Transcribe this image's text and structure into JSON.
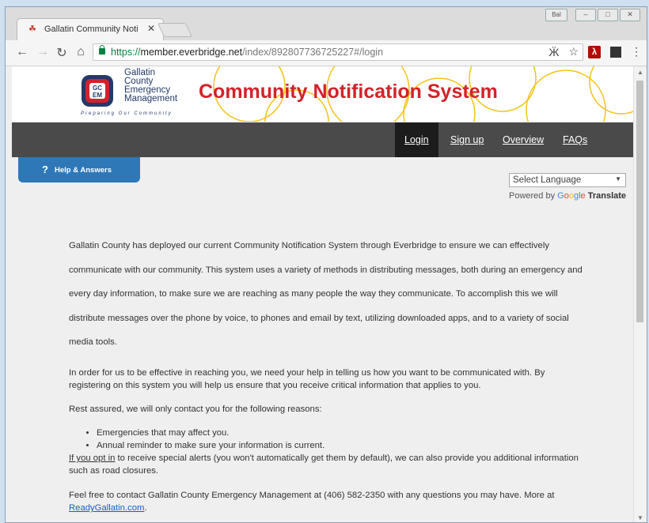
{
  "browser": {
    "tab_title": "Gallatin Community Noti",
    "url_scheme": "https://",
    "url_host": "member.everbridge.net",
    "url_path": "/index/892807736725227#/login",
    "user_badge": "Bal"
  },
  "site": {
    "logo_line1": "Gallatin",
    "logo_line2": "County",
    "logo_line3": "Emergency",
    "logo_line4": "Management",
    "logo_tagline": "Preparing Our Community",
    "title": "Community Notification System",
    "colors": {
      "accent_red": "#d3222a",
      "nav_bg": "#4a4a4a",
      "help_blue": "#2f78b8",
      "arc_yellow": "#f2c419"
    }
  },
  "nav": {
    "items": [
      {
        "label": "Login"
      },
      {
        "label": "Sign up"
      },
      {
        "label": "Overview"
      },
      {
        "label": "FAQs"
      }
    ]
  },
  "help": {
    "label": "Help & Answers",
    "icon": "question-icon"
  },
  "translate": {
    "select_value": "Select Language",
    "powered_by": "Powered by",
    "google_G": "G",
    "google_o1": "o",
    "google_o2": "o",
    "google_g": "g",
    "google_l": "l",
    "google_e": "e",
    "translate_word": "Translate"
  },
  "content": {
    "intro": "Gallatin County has deployed our current Community Notification System through Everbridge to ensure we can effectively communicate with our community.  This system uses a variety of methods in distributing messages, both during an emergency and every day information, to make sure we are reaching as many people the way they communicate.  To accomplish this we will distribute messages over the phone by voice, to phones and email by text, utilizing downloaded apps, and to a variety of social media tools.",
    "help_request": "In order for us to be effective in reaching you, we need your help in telling us how you want to be communicated with.  By registering on this system you will help us ensure that you receive critical information that applies to you.",
    "rest_assured": "Rest assured, we will only contact you for the following reasons:",
    "reasons": [
      "Emergencies that may affect you.",
      "Annual reminder to make sure your information is current."
    ],
    "opt_in_link": "If you opt in",
    "opt_in_rest": " to receive special alerts (you won't automatically get them by default), we can also provide you additional information such as road closures.",
    "contact": "Feel free to contact Gallatin County Emergency Management at (406) 582-2350 with any questions you may have.  More at",
    "contact_link": "ReadyGallatin.com",
    "contact_end": "."
  }
}
